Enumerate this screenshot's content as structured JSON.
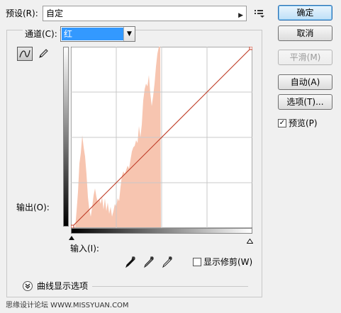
{
  "preset": {
    "label": "预设(R):",
    "value": "自定",
    "menu_icon": "list-menu-icon"
  },
  "channel": {
    "label": "通道(C):",
    "value": "红"
  },
  "graph": {
    "output_label": "输出(O):",
    "input_label": "输入(I):",
    "curve_color": "#c83c24",
    "histogram_color": "#f7c5b0"
  },
  "buttons": {
    "ok": "确定",
    "cancel": "取消",
    "smooth": "平滑(M)",
    "auto": "自动(A)",
    "options": "选项(T)..."
  },
  "preview": {
    "label": "预览(P)",
    "checked": true
  },
  "show_clipping": {
    "label": "显示修剪(W)",
    "checked": false
  },
  "curve_display_options": {
    "label": "曲线显示选项"
  },
  "watermark": "思缘设计论坛 WWW.MISSYUAN.COM"
}
